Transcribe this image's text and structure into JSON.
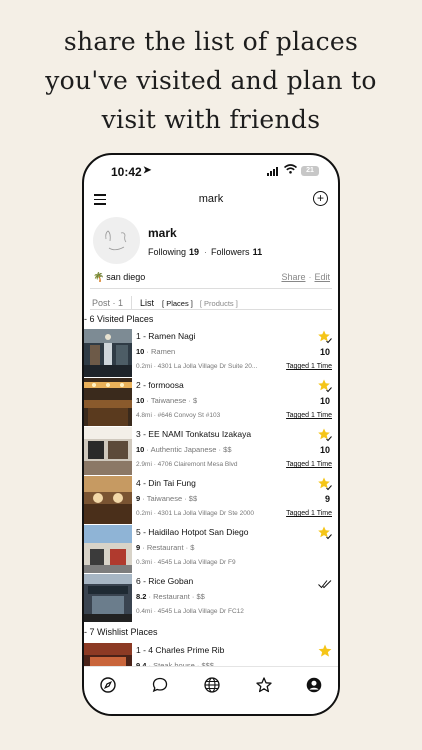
{
  "headline": [
    "share the list of places",
    "you've visited and plan to",
    "visit with friends"
  ],
  "status_bar": {
    "time": "10:42",
    "battery": "21"
  },
  "nav": {
    "title": "mark"
  },
  "profile": {
    "name": "mark",
    "following_label": "Following",
    "following_count": "19",
    "followers_label": "Followers",
    "followers_count": "11",
    "location": "san diego",
    "share_label": "Share",
    "edit_label": "Edit"
  },
  "tabs": {
    "post": "Post · 1",
    "list": "List",
    "places": "[ Places ]",
    "products": "[ Products ]"
  },
  "visited_header": "- 6 Visited Places",
  "visited": [
    {
      "title": "1 - Ramen Nagi",
      "score": "10",
      "meta": " · Ramen",
      "address": "0.2mi · 4301 La Jolla Village Dr Suite 20...",
      "right_score": "10",
      "tagged": "Tagged 1 Time"
    },
    {
      "title": "2 - formoosa",
      "score": "10",
      "meta": " · Taiwanese · $",
      "address": "4.8mi · #646 Convoy St #103",
      "right_score": "10",
      "tagged": "Tagged 1 Time"
    },
    {
      "title": "3 - EE NAMI Tonkatsu Izakaya",
      "score": "10",
      "meta": " · Authentic Japanese · $$",
      "address": "2.9mi · 4706 Clairemont Mesa Blvd",
      "right_score": "10",
      "tagged": "Tagged 1 Time"
    },
    {
      "title": "4 - Din Tai Fung",
      "score": "9",
      "meta": " · Taiwanese · $$",
      "address": "0.2mi · 4301 La Jolla Village Dr Ste 2000",
      "right_score": "9",
      "tagged": "Tagged 1 Time"
    },
    {
      "title": "5 - Haidilao Hotpot San Diego",
      "score": "9",
      "meta": " · Restaurant · $",
      "address": "0.3mi · 4545 La Jolla Village Dr F9",
      "right_score": "",
      "tagged": ""
    },
    {
      "title": "6 - Rice Goban",
      "score": "8.2",
      "meta": " · Restaurant · $$",
      "address": "0.4mi · 4545 La Jolla Village Dr FC12",
      "right_score": "",
      "tagged": ""
    }
  ],
  "wishlist_header": "- 7 Wishlist Places",
  "wishlist": [
    {
      "title": "1 - 4 Charles Prime Rib",
      "score": "9.4",
      "meta": " · Steak house · $$$"
    }
  ],
  "tabbar": [
    "compass-icon",
    "chat-icon",
    "globe-icon",
    "star-icon",
    "profile-icon"
  ],
  "colors": {
    "background": "#f4efe6",
    "star": "#f5c518",
    "text": "#111111"
  }
}
